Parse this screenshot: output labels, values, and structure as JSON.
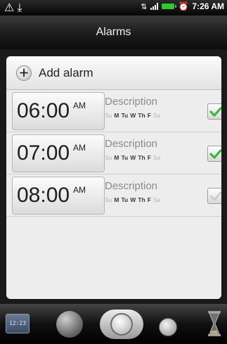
{
  "status_bar": {
    "left_icons": [
      "warning-icon",
      "usb-icon"
    ],
    "right_icons": [
      "data-icon",
      "signal-icon",
      "battery-icon",
      "alarm-clock-icon"
    ],
    "time": "7:26 AM"
  },
  "header": {
    "title": "Alarms"
  },
  "add_alarm": {
    "label": "Add alarm",
    "icon": "plus-icon"
  },
  "alarms": [
    {
      "time": "06:00",
      "ampm": "AM",
      "description": "Description",
      "days": [
        {
          "label": "Su",
          "on": false
        },
        {
          "label": "M",
          "on": true
        },
        {
          "label": "Tu",
          "on": true
        },
        {
          "label": "W",
          "on": true
        },
        {
          "label": "Th",
          "on": true
        },
        {
          "label": "F",
          "on": true
        },
        {
          "label": "Sa",
          "on": false
        }
      ],
      "enabled": true
    },
    {
      "time": "07:00",
      "ampm": "AM",
      "description": "Description",
      "days": [
        {
          "label": "Su",
          "on": false
        },
        {
          "label": "M",
          "on": true
        },
        {
          "label": "Tu",
          "on": true
        },
        {
          "label": "W",
          "on": true
        },
        {
          "label": "Th",
          "on": true
        },
        {
          "label": "F",
          "on": true
        },
        {
          "label": "Sa",
          "on": false
        }
      ],
      "enabled": true
    },
    {
      "time": "08:00",
      "ampm": "AM",
      "description": "Description",
      "days": [
        {
          "label": "Su",
          "on": false
        },
        {
          "label": "M",
          "on": true
        },
        {
          "label": "Tu",
          "on": true
        },
        {
          "label": "W",
          "on": true
        },
        {
          "label": "Th",
          "on": true
        },
        {
          "label": "F",
          "on": true
        },
        {
          "label": "Sa",
          "on": false
        }
      ],
      "enabled": false
    }
  ],
  "bottom_tabs": [
    {
      "icon": "digital-clock-icon",
      "clock_text": "12:23",
      "selected": false
    },
    {
      "icon": "globe-icon",
      "selected": false
    },
    {
      "icon": "alarm-clock-icon",
      "selected": true
    },
    {
      "icon": "stopwatch-icon",
      "selected": false
    },
    {
      "icon": "hourglass-icon",
      "selected": false
    }
  ],
  "colors": {
    "check_on": "#3cb83c",
    "check_off": "#c8c8c8",
    "day_on": "#3b3b3b",
    "day_off": "#b2b2b2",
    "battery": "#32c832"
  }
}
